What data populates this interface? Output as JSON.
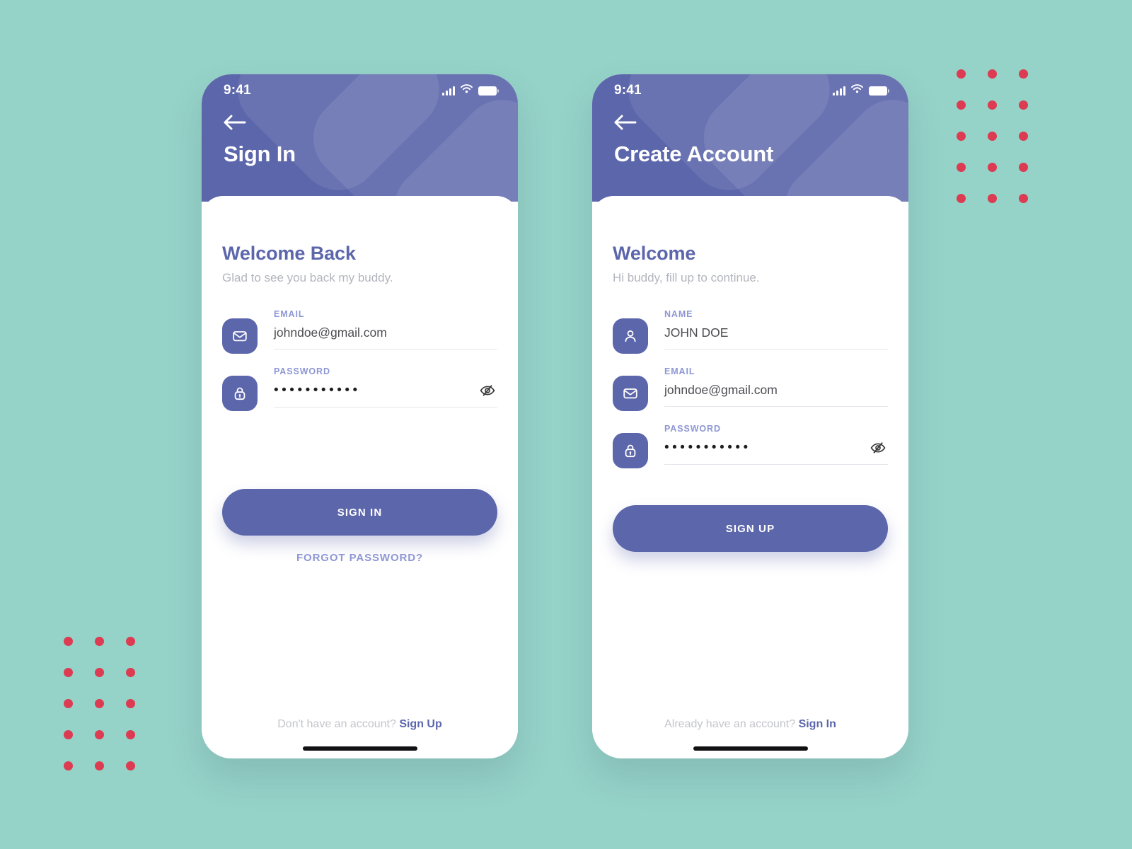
{
  "background_color": "#95d2c8",
  "accent_color": "#5c66ab",
  "dot_color": "#dc3b52",
  "decor": {
    "dots_top_right_label": "dot-grid-decoration",
    "dots_bottom_left_label": "dot-grid-decoration",
    "columns": 3,
    "rows": 5
  },
  "signin": {
    "status": {
      "time": "9:41",
      "signal": "signal-icon",
      "wifi": "wifi-icon",
      "battery": "battery-icon"
    },
    "back_label": "back-arrow",
    "title": "Sign In",
    "welcome_title": "Welcome Back",
    "welcome_sub": "Glad to see you back my buddy.",
    "fields": [
      {
        "icon": "mail-icon",
        "label": "EMAIL",
        "value": "johndoe@gmail.com",
        "type": "email",
        "toggle": false
      },
      {
        "icon": "lock-icon",
        "label": "PASSWORD",
        "value": "•••••••••••",
        "type": "password",
        "toggle": true,
        "toggle_icon": "eye-off-icon"
      }
    ],
    "primary_button": "SIGN IN",
    "forgot_link": "FORGOT PASSWORD?",
    "footer_text": "Don't have an account?",
    "footer_link": "Sign Up"
  },
  "signup": {
    "status": {
      "time": "9:41",
      "signal": "signal-icon",
      "wifi": "wifi-icon",
      "battery": "battery-icon"
    },
    "back_label": "back-arrow",
    "title": "Create Account",
    "welcome_title": "Welcome",
    "welcome_sub": "Hi buddy, fill up to continue.",
    "fields": [
      {
        "icon": "user-icon",
        "label": "NAME",
        "value": "JOHN DOE",
        "type": "text",
        "toggle": false
      },
      {
        "icon": "mail-icon",
        "label": "EMAIL",
        "value": "johndoe@gmail.com",
        "type": "email",
        "toggle": false
      },
      {
        "icon": "lock-icon",
        "label": "PASSWORD",
        "value": "•••••••••••",
        "type": "password",
        "toggle": true,
        "toggle_icon": "eye-off-icon"
      }
    ],
    "primary_button": "SIGN UP",
    "footer_text": "Already have an account?",
    "footer_link": "Sign In"
  }
}
